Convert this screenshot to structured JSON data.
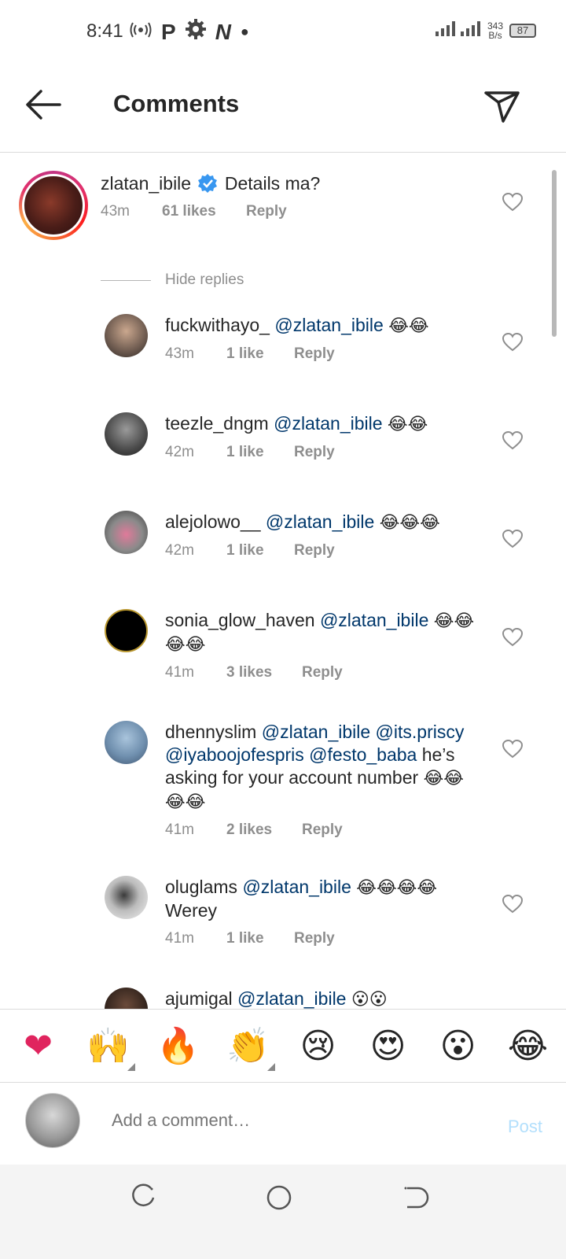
{
  "status": {
    "time": "8:41",
    "net_speed_top": "343",
    "net_speed_bottom": "B/s",
    "battery": "87",
    "network_type": "4G"
  },
  "header": {
    "title": "Comments"
  },
  "main_comment": {
    "username": "zlatan_ibile",
    "text": "Details ma?",
    "time": "43m",
    "likes": "61 likes",
    "reply": "Reply"
  },
  "hide_replies": "Hide replies",
  "replies": [
    {
      "username": "fuckwithayo_",
      "mention": "@zlatan_ibile",
      "text": "",
      "emoji": "😂😂",
      "time": "43m",
      "likes": "1 like",
      "reply": "Reply"
    },
    {
      "username": "teezle_dngm",
      "mention": "@zlatan_ibile",
      "text": "",
      "emoji": "😂😂",
      "time": "42m",
      "likes": "1 like",
      "reply": "Reply"
    },
    {
      "username": "alejolowo__",
      "mention": "@zlatan_ibile",
      "text": "",
      "emoji": "😂😂😂",
      "time": "42m",
      "likes": "1 like",
      "reply": "Reply"
    },
    {
      "username": "sonia_glow_haven",
      "mention": "@zlatan_ibile",
      "text": "",
      "emoji": "😂😂",
      "emoji2": "😂😂",
      "time": "41m",
      "likes": "3 likes",
      "reply": "Reply"
    },
    {
      "username": "dhennyslim",
      "mention": "@zlatan_ibile @its.priscy",
      "mention2": "@iyaboojofespris @festo_baba",
      "text": "he’s",
      "text2": "asking for your account number",
      "emoji": "😂😂",
      "emoji2": "😂😂",
      "time": "41m",
      "likes": "2 likes",
      "reply": "Reply"
    },
    {
      "username": "oluglams",
      "mention": "@zlatan_ibile",
      "text": "",
      "emoji": "😂😂😂😂",
      "text2": "Werey",
      "time": "41m",
      "likes": "1 like",
      "reply": "Reply"
    },
    {
      "username": "ajumigal",
      "mention": "@zlatan_ibile",
      "emoji": "😮😮"
    }
  ],
  "reactions": [
    "❤",
    "🙌",
    "🔥",
    "👏",
    "😢",
    "😍",
    "😮",
    "😂"
  ],
  "composer": {
    "placeholder": "Add a comment…",
    "post": "Post"
  }
}
